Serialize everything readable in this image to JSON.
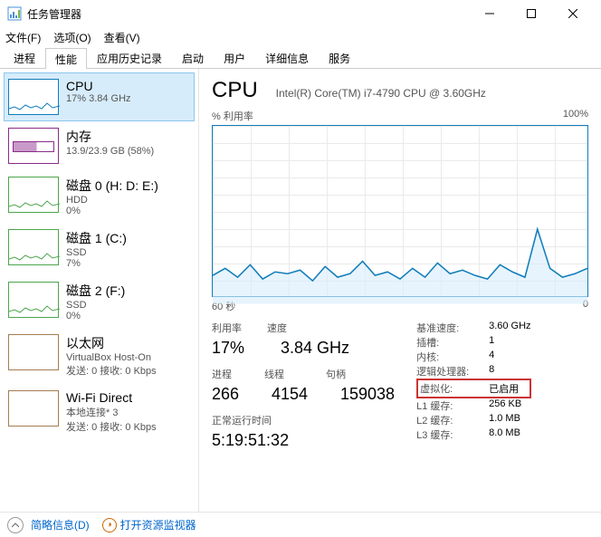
{
  "window": {
    "title": "任务管理器"
  },
  "menu": {
    "file": "文件(F)",
    "options": "选项(O)",
    "view": "查看(V)"
  },
  "tabs": [
    "进程",
    "性能",
    "应用历史记录",
    "启动",
    "用户",
    "详细信息",
    "服务"
  ],
  "active_tab": 1,
  "sidebar": [
    {
      "title": "CPU",
      "sub": "17% 3.84 GHz",
      "kind": "cpu",
      "selected": true
    },
    {
      "title": "内存",
      "sub": "13.9/23.9 GB (58%)",
      "kind": "mem"
    },
    {
      "title": "磁盘 0 (H: D: E:)",
      "sub": "HDD",
      "sub2": "0%",
      "kind": "disk"
    },
    {
      "title": "磁盘 1 (C:)",
      "sub": "SSD",
      "sub2": "7%",
      "kind": "disk"
    },
    {
      "title": "磁盘 2 (F:)",
      "sub": "SSD",
      "sub2": "0%",
      "kind": "disk"
    },
    {
      "title": "以太网",
      "sub": "VirtualBox Host-On",
      "sub2": "发送: 0 接收: 0 Kbps",
      "kind": "eth"
    },
    {
      "title": "Wi-Fi Direct",
      "sub": "本地连接* 3",
      "sub2": "发送: 0 接收: 0 Kbps",
      "kind": "wifi"
    }
  ],
  "main": {
    "title": "CPU",
    "model": "Intel(R) Core(TM) i7-4790 CPU @ 3.60GHz",
    "util_label": "% 利用率",
    "util_max": "100%",
    "axis_left": "60 秒",
    "axis_right": "0",
    "row1": {
      "util_l": "利用率",
      "speed_l": "速度",
      "util_v": "17%",
      "speed_v": "3.84 GHz"
    },
    "row2": {
      "proc_l": "进程",
      "thread_l": "线程",
      "handle_l": "句柄",
      "proc_v": "266",
      "thread_v": "4154",
      "handle_v": "159038"
    },
    "uptime_l": "正常运行时间",
    "uptime_v": "5:19:51:32",
    "right": {
      "base_l": "基准速度:",
      "base_v": "3.60 GHz",
      "sock_l": "插槽:",
      "sock_v": "1",
      "core_l": "内核:",
      "core_v": "4",
      "lp_l": "逻辑处理器:",
      "lp_v": "8",
      "virt_l": "虚拟化:",
      "virt_v": "已启用",
      "l1_l": "L1 缓存:",
      "l1_v": "256 KB",
      "l2_l": "L2 缓存:",
      "l2_v": "1.0 MB",
      "l3_l": "L3 缓存:",
      "l3_v": "8.0 MB"
    }
  },
  "footer": {
    "brief": "简略信息(D)",
    "rmon": "打开资源监视器"
  },
  "chart_data": {
    "type": "line",
    "title": "% 利用率",
    "xlabel": "60 秒 → 0",
    "ylabel": "% 利用率",
    "ylim": [
      0,
      100
    ],
    "x": [
      60,
      58,
      56,
      54,
      52,
      50,
      48,
      46,
      44,
      42,
      40,
      38,
      36,
      34,
      32,
      30,
      28,
      26,
      24,
      22,
      20,
      18,
      16,
      14,
      12,
      10,
      8,
      6,
      4,
      2,
      0
    ],
    "values": [
      16,
      20,
      15,
      22,
      14,
      18,
      17,
      19,
      13,
      21,
      15,
      17,
      24,
      16,
      18,
      14,
      20,
      15,
      23,
      17,
      19,
      16,
      14,
      22,
      18,
      15,
      42,
      20,
      15,
      17,
      20
    ]
  }
}
